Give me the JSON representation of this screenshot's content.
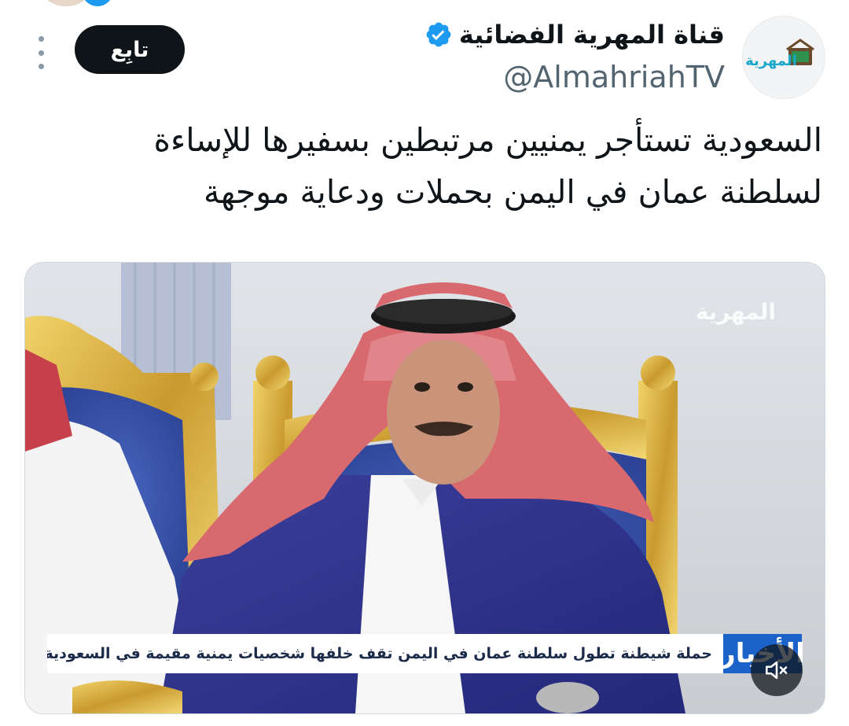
{
  "header": {
    "display_name": "قناة المهرية الفضائية",
    "handle": "@AlmahriahTV",
    "follow_label": "تابِع",
    "avatar_logo_text": "المهرية",
    "verified": true
  },
  "tweet": {
    "text_line_1": "السعودية تستأجر يمنيين مرتبطين بسفيرها للإساءة",
    "text_line_2": "لسلطنة عمان في اليمن بحملات ودعاية موجهة"
  },
  "media": {
    "watermark": "المهرية",
    "ticker_logo": "الأخبار",
    "ticker_text": "حملة شيطنة تطول سلطنة عمان في اليمن تقف خلفها شخصيات يمنية مقيمة في السعودية",
    "muted": true
  },
  "colors": {
    "accent": "#1d9bf0",
    "text_primary": "#0f1419",
    "text_secondary": "#536471",
    "follow_bg": "#0f1419"
  },
  "icons": {
    "more": "more-vertical-icon",
    "verified": "verified-badge-icon",
    "mute": "volume-muted-icon"
  }
}
